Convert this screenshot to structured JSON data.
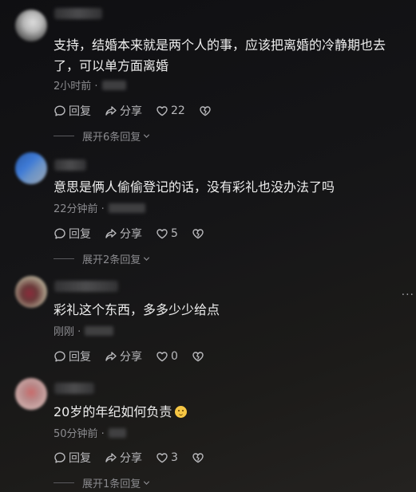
{
  "comments": [
    {
      "text": "支持，结婚本来就是两个人的事，应该把离婚的冷静期也去了，可以单方面离婚",
      "time": "2小时前 ·",
      "reply": "回复",
      "share": "分享",
      "likes": "22",
      "expand": "展开6条回复"
    },
    {
      "text": "意思是俩人偷偷登记的话，没有彩礼也没办法了吗",
      "time": "22分钟前 ·",
      "reply": "回复",
      "share": "分享",
      "likes": "5",
      "expand": "展开2条回复"
    },
    {
      "text": "彩礼这个东西，多多少少给点",
      "time": "刚刚 ·",
      "reply": "回复",
      "share": "分享",
      "likes": "0"
    },
    {
      "text": "20岁的年纪如何负责",
      "time": "50分钟前 ·",
      "reply": "回复",
      "share": "分享",
      "likes": "3",
      "expand": "展开1条回复"
    }
  ],
  "more_menu": "···",
  "icons": {
    "reply": "comment-bubble-icon",
    "share": "share-arrow-icon",
    "like": "heart-icon",
    "dislike": "broken-heart-icon",
    "emoji": "smiling-face-emoji"
  },
  "colors": {
    "background": "#151517",
    "text": "#eeeeee",
    "muted": "#8c8c90",
    "action": "#b9b9bc"
  }
}
